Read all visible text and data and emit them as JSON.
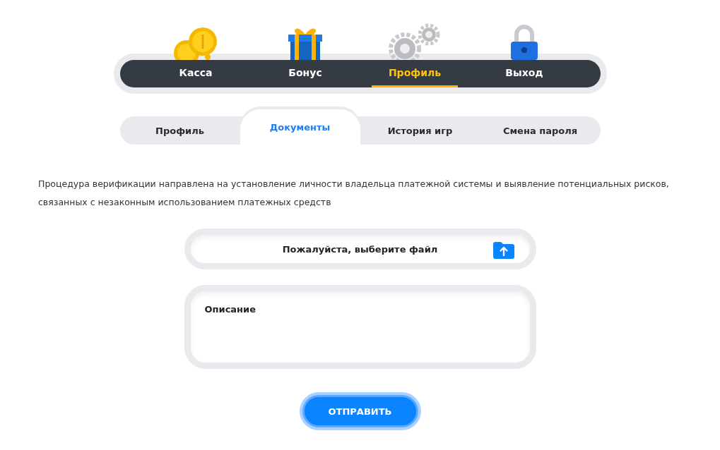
{
  "main_nav": [
    {
      "label": "Касса",
      "selected": false
    },
    {
      "label": "Бонус",
      "selected": false
    },
    {
      "label": "Профиль",
      "selected": true
    },
    {
      "label": "Выход",
      "selected": false
    }
  ],
  "sub_tabs": [
    {
      "label": "Профиль",
      "selected": false
    },
    {
      "label": "Документы",
      "selected": true
    },
    {
      "label": "История игр",
      "selected": false
    },
    {
      "label": "Смена пароля",
      "selected": false
    }
  ],
  "intro": "Процедура верификации направлена на установление личности владельца платежной системы и выявление потенциальных рисков, связанных с незаконным использованием платежных средств",
  "file_field": {
    "label": "Пожалуйста, выберите файл"
  },
  "description_field": {
    "placeholder": "Описание"
  },
  "submit_button": "ОТПРАВИТЬ"
}
